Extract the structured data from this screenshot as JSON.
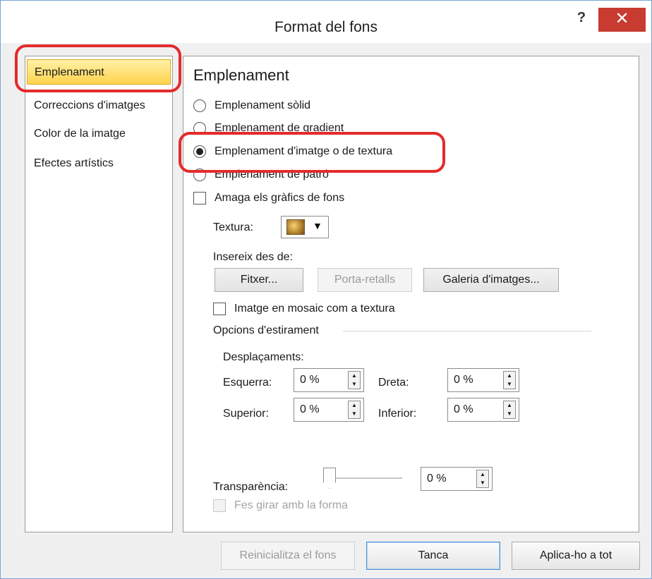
{
  "window": {
    "title": "Format del fons",
    "help_label": "?",
    "close_label": "✕",
    "accent": "#c73b30",
    "highlight": "#e32b2b"
  },
  "sidebar": {
    "items": [
      {
        "label": "Emplenament",
        "active": true
      },
      {
        "label": "Correccions d'imatges",
        "active": false
      },
      {
        "label": "Color de la imatge",
        "active": false
      },
      {
        "label": "Efectes artístics",
        "active": false
      }
    ]
  },
  "panel": {
    "title": "Emplenament",
    "fill_options": [
      {
        "label": "Emplenament sòlid",
        "checked": false
      },
      {
        "label": "Emplenament de gradient",
        "checked": false
      },
      {
        "label": "Emplenament d'imatge o de textura",
        "checked": true
      },
      {
        "label": "Emplenament de patró",
        "checked": false
      }
    ],
    "hide_background_label": "Amaga els gràfics de fons",
    "texture_label": "Textura:",
    "texture_icon": "texture-swatch-icon",
    "insert_from_label": "Insereix des de:",
    "file_button": "Fitxer...",
    "clipboard_button": "Porta-retalls",
    "gallery_button": "Galeria d'imatges...",
    "tile_label": "Imatge en mosaic com a textura",
    "stretch_options_label": "Opcions d'estirament",
    "offsets_label": "Desplaçaments:",
    "left_label": "Esquerra:",
    "left_value": "0 %",
    "right_label": "Dreta:",
    "right_value": "0 %",
    "top_label": "Superior:",
    "top_value": "0 %",
    "bottom_label": "Inferior:",
    "bottom_value": "0 %",
    "transparency_label": "Transparència:",
    "transparency_value": "0 %",
    "rotate_label": "Fes girar amb la forma"
  },
  "footer": {
    "reset_button": "Reinicialitza el fons",
    "close_button": "Tanca",
    "apply_all_button": "Aplica-ho a tot"
  }
}
